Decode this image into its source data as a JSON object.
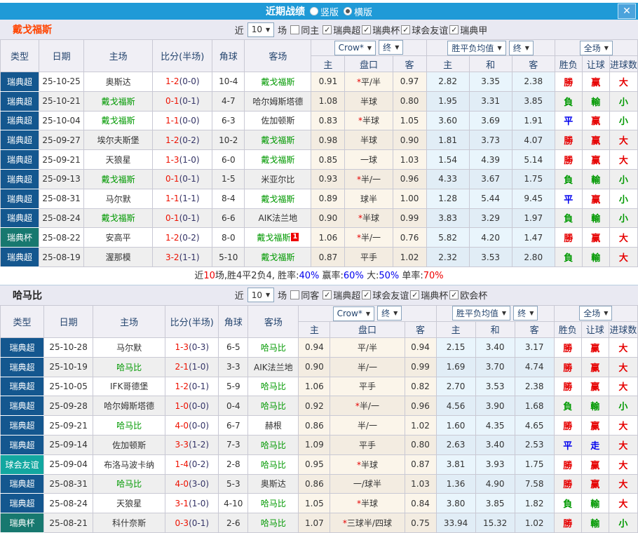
{
  "icons": {
    "close": "✕",
    "check": "✓",
    "dropdown_arrow": "▼"
  },
  "topbar": {
    "title": "近期战绩",
    "options": [
      {
        "label": "竖版",
        "selected": false
      },
      {
        "label": "横版",
        "selected": true
      }
    ]
  },
  "header": {
    "cols": [
      "类型",
      "日期",
      "主场",
      "比分(半场)",
      "角球",
      "客场"
    ],
    "odds_dropdown": "Crow*",
    "odds_final": "终",
    "odds_sub": [
      "主",
      "盘口",
      "客"
    ],
    "avg_dropdown": "胜平负均值",
    "avg_final": "终",
    "avg_sub": [
      "主",
      "和",
      "客"
    ],
    "scope_dropdown": "全场",
    "result_sub": [
      "胜负",
      "让球",
      "进球数"
    ]
  },
  "sections": [
    {
      "team": "戴戈福斯",
      "near_label": "近",
      "match_count": "10",
      "games_label": "场",
      "same_side_label": "同主",
      "same_side_checked": false,
      "leagues": [
        {
          "label": "瑞典超",
          "checked": true
        },
        {
          "label": "瑞典杯",
          "checked": true
        },
        {
          "label": "球会友谊",
          "checked": true
        },
        {
          "label": "瑞典甲",
          "checked": true
        }
      ],
      "summary": [
        {
          "t": "近",
          "c": "k"
        },
        {
          "t": "10",
          "c": "r"
        },
        {
          "t": "场,胜4平2负4, 胜率:",
          "c": "k"
        },
        {
          "t": "40%",
          "c": "b"
        },
        {
          "t": " 赢率:",
          "c": "k"
        },
        {
          "t": "60%",
          "c": "b"
        },
        {
          "t": " 大:",
          "c": "k"
        },
        {
          "t": "50%",
          "c": "b"
        },
        {
          "t": " 单率:",
          "c": "k"
        },
        {
          "t": "70%",
          "c": "r"
        }
      ]
    },
    {
      "team": "哈马比",
      "near_label": "近",
      "match_count": "10",
      "games_label": "场",
      "same_side_label": "同客",
      "same_side_checked": false,
      "leagues": [
        {
          "label": "瑞典超",
          "checked": true
        },
        {
          "label": "球会友谊",
          "checked": true
        },
        {
          "label": "瑞典杯",
          "checked": true
        },
        {
          "label": "欧会杯",
          "checked": true
        }
      ]
    }
  ],
  "tables": [
    {
      "rows": [
        {
          "comp": "瑞典超",
          "comp_style": "t-super",
          "date": "25-10-25",
          "home": "奥斯达",
          "home_hl": false,
          "score": "1-2",
          "half": "(0-0)",
          "corner": "10-4",
          "away": "戴戈福斯",
          "away_hl": true,
          "odds": [
            "0.91",
            "*平/半",
            "0.97"
          ],
          "avg": [
            "2.82",
            "3.35",
            "2.38"
          ],
          "res": [
            "勝",
            "赢",
            "大"
          ],
          "res_c": [
            "r",
            "r",
            "r"
          ]
        },
        {
          "comp": "瑞典超",
          "comp_style": "t-super",
          "date": "25-10-21",
          "home": "戴戈福斯",
          "home_hl": true,
          "score": "0-1",
          "half": "(0-1)",
          "corner": "4-7",
          "away": "哈尔姆斯塔德",
          "away_hl": false,
          "odds": [
            "1.08",
            "半球",
            "0.80"
          ],
          "avg": [
            "1.95",
            "3.31",
            "3.85"
          ],
          "res": [
            "負",
            "輸",
            "小"
          ],
          "res_c": [
            "g",
            "g",
            "g"
          ]
        },
        {
          "comp": "瑞典超",
          "comp_style": "t-super",
          "date": "25-10-04",
          "home": "戴戈福斯",
          "home_hl": true,
          "score": "1-1",
          "half": "(0-0)",
          "corner": "6-3",
          "away": "佐加顿斯",
          "away_hl": false,
          "odds": [
            "0.83",
            "*半球",
            "1.05"
          ],
          "avg": [
            "3.60",
            "3.69",
            "1.91"
          ],
          "res": [
            "平",
            "赢",
            "小"
          ],
          "res_c": [
            "b",
            "r",
            "g"
          ]
        },
        {
          "comp": "瑞典超",
          "comp_style": "t-super",
          "date": "25-09-27",
          "home": "埃尔夫斯堡",
          "home_hl": false,
          "score": "1-2",
          "half": "(0-2)",
          "corner": "10-2",
          "away": "戴戈福斯",
          "away_hl": true,
          "odds": [
            "0.98",
            "半球",
            "0.90"
          ],
          "avg": [
            "1.81",
            "3.73",
            "4.07"
          ],
          "res": [
            "勝",
            "赢",
            "大"
          ],
          "res_c": [
            "r",
            "r",
            "r"
          ]
        },
        {
          "comp": "瑞典超",
          "comp_style": "t-super",
          "date": "25-09-21",
          "home": "天狼星",
          "home_hl": false,
          "score": "1-3",
          "half": "(1-0)",
          "corner": "6-0",
          "away": "戴戈福斯",
          "away_hl": true,
          "odds": [
            "0.85",
            "一球",
            "1.03"
          ],
          "avg": [
            "1.54",
            "4.39",
            "5.14"
          ],
          "res": [
            "勝",
            "赢",
            "大"
          ],
          "res_c": [
            "r",
            "r",
            "r"
          ]
        },
        {
          "comp": "瑞典超",
          "comp_style": "t-super",
          "date": "25-09-13",
          "home": "戴戈福斯",
          "home_hl": true,
          "score": "0-1",
          "half": "(0-1)",
          "corner": "1-5",
          "away": "米亚尔比",
          "away_hl": false,
          "odds": [
            "0.93",
            "*半/一",
            "0.96"
          ],
          "avg": [
            "4.33",
            "3.67",
            "1.75"
          ],
          "res": [
            "負",
            "輸",
            "小"
          ],
          "res_c": [
            "g",
            "g",
            "g"
          ]
        },
        {
          "comp": "瑞典超",
          "comp_style": "t-super",
          "date": "25-08-31",
          "home": "马尔默",
          "home_hl": false,
          "score": "1-1",
          "half": "(1-1)",
          "corner": "8-4",
          "away": "戴戈福斯",
          "away_hl": true,
          "odds": [
            "0.89",
            "球半",
            "1.00"
          ],
          "avg": [
            "1.28",
            "5.44",
            "9.45"
          ],
          "res": [
            "平",
            "赢",
            "小"
          ],
          "res_c": [
            "b",
            "r",
            "g"
          ]
        },
        {
          "comp": "瑞典超",
          "comp_style": "t-super",
          "date": "25-08-24",
          "home": "戴戈福斯",
          "home_hl": true,
          "score": "0-1",
          "half": "(0-1)",
          "corner": "6-6",
          "away": "AIK法兰地",
          "away_hl": false,
          "odds": [
            "0.90",
            "*半球",
            "0.99"
          ],
          "avg": [
            "3.83",
            "3.29",
            "1.97"
          ],
          "res": [
            "負",
            "輸",
            "小"
          ],
          "res_c": [
            "g",
            "g",
            "g"
          ]
        },
        {
          "comp": "瑞典杯",
          "comp_style": "t-cup",
          "date": "25-08-22",
          "home": "安高平",
          "home_hl": false,
          "score": "1-2",
          "half": "(0-2)",
          "corner": "8-0",
          "away": "戴戈福斯",
          "away_hl": true,
          "away_badge": "1",
          "odds": [
            "1.06",
            "*半/一",
            "0.76"
          ],
          "avg": [
            "5.82",
            "4.20",
            "1.47"
          ],
          "res": [
            "勝",
            "赢",
            "大"
          ],
          "res_c": [
            "r",
            "r",
            "r"
          ]
        },
        {
          "comp": "瑞典超",
          "comp_style": "t-super",
          "date": "25-08-19",
          "home": "渥那模",
          "home_hl": false,
          "score": "3-2",
          "half": "(1-1)",
          "corner": "5-10",
          "away": "戴戈福斯",
          "away_hl": true,
          "odds": [
            "0.87",
            "平手",
            "1.02"
          ],
          "avg": [
            "2.32",
            "3.53",
            "2.80"
          ],
          "res": [
            "負",
            "輸",
            "大"
          ],
          "res_c": [
            "g",
            "g",
            "r"
          ]
        }
      ]
    },
    {
      "rows": [
        {
          "comp": "瑞典超",
          "comp_style": "t-super",
          "date": "25-10-28",
          "home": "马尔默",
          "home_hl": false,
          "score": "1-3",
          "half": "(0-3)",
          "corner": "6-5",
          "away": "哈马比",
          "away_hl": true,
          "odds": [
            "0.94",
            "平/半",
            "0.94"
          ],
          "avg": [
            "2.15",
            "3.40",
            "3.17"
          ],
          "res": [
            "勝",
            "赢",
            "大"
          ],
          "res_c": [
            "r",
            "r",
            "r"
          ]
        },
        {
          "comp": "瑞典超",
          "comp_style": "t-super",
          "date": "25-10-19",
          "home": "哈马比",
          "home_hl": true,
          "score": "2-1",
          "half": "(1-0)",
          "corner": "3-3",
          "away": "AIK法兰地",
          "away_hl": false,
          "odds": [
            "0.90",
            "半/一",
            "0.99"
          ],
          "avg": [
            "1.69",
            "3.70",
            "4.74"
          ],
          "res": [
            "勝",
            "赢",
            "大"
          ],
          "res_c": [
            "r",
            "r",
            "r"
          ]
        },
        {
          "comp": "瑞典超",
          "comp_style": "t-super",
          "date": "25-10-05",
          "home": "IFK哥德堡",
          "home_hl": false,
          "score": "1-2",
          "half": "(0-1)",
          "corner": "5-9",
          "away": "哈马比",
          "away_hl": true,
          "odds": [
            "1.06",
            "平手",
            "0.82"
          ],
          "avg": [
            "2.70",
            "3.53",
            "2.38"
          ],
          "res": [
            "勝",
            "赢",
            "大"
          ],
          "res_c": [
            "r",
            "r",
            "r"
          ]
        },
        {
          "comp": "瑞典超",
          "comp_style": "t-super",
          "date": "25-09-28",
          "home": "哈尔姆斯塔德",
          "home_hl": false,
          "score": "1-0",
          "half": "(0-0)",
          "corner": "0-4",
          "away": "哈马比",
          "away_hl": true,
          "odds": [
            "0.92",
            "*半/一",
            "0.96"
          ],
          "avg": [
            "4.56",
            "3.90",
            "1.68"
          ],
          "res": [
            "負",
            "輸",
            "小"
          ],
          "res_c": [
            "g",
            "g",
            "g"
          ]
        },
        {
          "comp": "瑞典超",
          "comp_style": "t-super",
          "date": "25-09-21",
          "home": "哈马比",
          "home_hl": true,
          "score": "4-0",
          "half": "(0-0)",
          "corner": "6-7",
          "away": "赫根",
          "away_hl": false,
          "odds": [
            "0.86",
            "半/一",
            "1.02"
          ],
          "avg": [
            "1.60",
            "4.35",
            "4.65"
          ],
          "res": [
            "勝",
            "赢",
            "大"
          ],
          "res_c": [
            "r",
            "r",
            "r"
          ]
        },
        {
          "comp": "瑞典超",
          "comp_style": "t-super",
          "date": "25-09-14",
          "home": "佐加顿斯",
          "home_hl": false,
          "score": "3-3",
          "half": "(1-2)",
          "corner": "7-3",
          "away": "哈马比",
          "away_hl": true,
          "odds": [
            "1.09",
            "平手",
            "0.80"
          ],
          "avg": [
            "2.63",
            "3.40",
            "2.53"
          ],
          "res": [
            "平",
            "走",
            "大"
          ],
          "res_c": [
            "b",
            "b",
            "r"
          ]
        },
        {
          "comp": "球会友谊",
          "comp_style": "t-fri",
          "date": "25-09-04",
          "home": "布洛马波卡纳",
          "home_hl": false,
          "score": "1-4",
          "half": "(0-2)",
          "corner": "2-8",
          "away": "哈马比",
          "away_hl": true,
          "odds": [
            "0.95",
            "*半球",
            "0.87"
          ],
          "avg": [
            "3.81",
            "3.93",
            "1.75"
          ],
          "res": [
            "勝",
            "赢",
            "大"
          ],
          "res_c": [
            "r",
            "r",
            "r"
          ]
        },
        {
          "comp": "瑞典超",
          "comp_style": "t-super",
          "date": "25-08-31",
          "home": "哈马比",
          "home_hl": true,
          "score": "4-0",
          "half": "(3-0)",
          "corner": "5-3",
          "away": "奥斯达",
          "away_hl": false,
          "odds": [
            "0.86",
            "一/球半",
            "1.03"
          ],
          "avg": [
            "1.36",
            "4.90",
            "7.58"
          ],
          "res": [
            "勝",
            "赢",
            "大"
          ],
          "res_c": [
            "r",
            "r",
            "r"
          ]
        },
        {
          "comp": "瑞典超",
          "comp_style": "t-super",
          "date": "25-08-24",
          "home": "天狼星",
          "home_hl": false,
          "score": "3-1",
          "half": "(1-0)",
          "corner": "4-10",
          "away": "哈马比",
          "away_hl": true,
          "odds": [
            "1.05",
            "*半球",
            "0.84"
          ],
          "avg": [
            "3.80",
            "3.85",
            "1.82"
          ],
          "res": [
            "負",
            "輸",
            "大"
          ],
          "res_c": [
            "g",
            "g",
            "r"
          ]
        },
        {
          "comp": "瑞典杯",
          "comp_style": "t-cup",
          "date": "25-08-21",
          "home": "科什奈斯",
          "home_hl": false,
          "score": "0-3",
          "half": "(0-1)",
          "corner": "2-6",
          "away": "哈马比",
          "away_hl": true,
          "odds": [
            "1.07",
            "*三球半/四球",
            "0.75"
          ],
          "avg": [
            "33.94",
            "15.32",
            "1.02"
          ],
          "res": [
            "勝",
            "輸",
            "小"
          ],
          "res_c": [
            "r",
            "g",
            "g"
          ]
        }
      ]
    }
  ]
}
